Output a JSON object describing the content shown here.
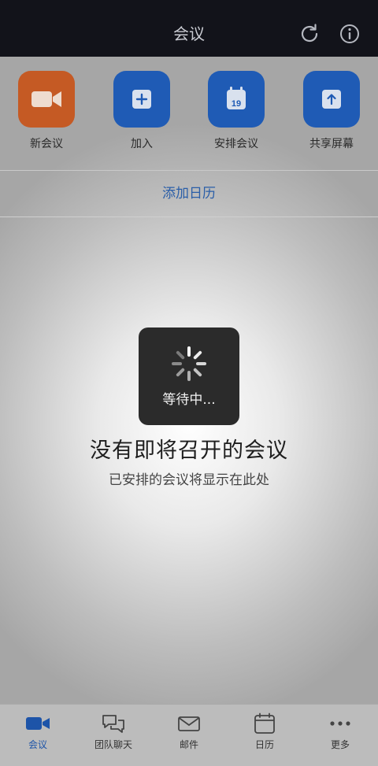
{
  "header": {
    "title": "会议"
  },
  "icons": {
    "refresh": "refresh-icon",
    "info": "info-icon"
  },
  "actions": [
    {
      "label": "新会议",
      "icon": "video-camera-icon",
      "color": "#c55a24"
    },
    {
      "label": "加入",
      "icon": "plus-icon",
      "color": "#1f5bb5"
    },
    {
      "label": "安排会议",
      "icon": "calendar-icon",
      "color": "#1f5bb5",
      "icon_text": "19"
    },
    {
      "label": "共享屏幕",
      "icon": "share-screen-icon",
      "color": "#1f5bb5"
    }
  ],
  "add_calendar": "添加日历",
  "loading": {
    "text": "等待中..."
  },
  "empty": {
    "title": "没有即将召开的会议",
    "subtitle": "已安排的会议将显示在此处"
  },
  "tabs": [
    {
      "label": "会议",
      "icon": "video-camera-icon",
      "active": true
    },
    {
      "label": "团队聊天",
      "icon": "chat-bubbles-icon",
      "active": false
    },
    {
      "label": "邮件",
      "icon": "mail-icon",
      "active": false
    },
    {
      "label": "日历",
      "icon": "calendar-icon",
      "active": false
    },
    {
      "label": "更多",
      "icon": "more-dots-icon",
      "active": false
    }
  ],
  "colors": {
    "accent": "#1d54a8",
    "header_bg": "#12131a",
    "orange": "#c55a24"
  }
}
